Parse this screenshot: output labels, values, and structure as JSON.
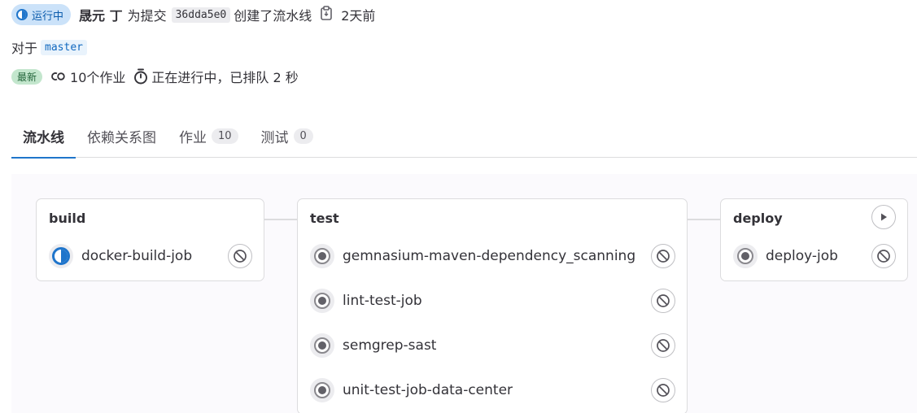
{
  "header": {
    "status_label": "运行中",
    "author": "晟元 丁",
    "commit_prefix": "为提交",
    "commit_sha": "36dda5e0",
    "commit_suffix": "创建了流水线",
    "time_ago": "2天前",
    "ref_prefix": "对于",
    "branch": "master",
    "latest_badge": "最新",
    "jobs_count": "10个作业",
    "running_status": "正在进行中，已排队 2 秒"
  },
  "tabs": [
    {
      "label": "流水线",
      "active": true
    },
    {
      "label": "依赖关系图"
    },
    {
      "label": "作业",
      "count": "10"
    },
    {
      "label": "测试",
      "count": "0"
    }
  ],
  "stages": [
    {
      "name": "build",
      "jobs": [
        {
          "name": "docker-build-job",
          "status": "running",
          "action": "cancel"
        }
      ]
    },
    {
      "name": "test",
      "jobs": [
        {
          "name": "gemnasium-maven-dependency_scanning",
          "status": "created",
          "action": "cancel"
        },
        {
          "name": "lint-test-job",
          "status": "created",
          "action": "cancel"
        },
        {
          "name": "semgrep-sast",
          "status": "created",
          "action": "cancel"
        },
        {
          "name": "unit-test-job-data-center",
          "status": "created",
          "action": "cancel"
        }
      ]
    },
    {
      "name": "deploy",
      "stage_action": "play",
      "jobs": [
        {
          "name": "deploy-job",
          "status": "created",
          "action": "cancel"
        }
      ]
    }
  ],
  "icons": {
    "status": "status-running-icon",
    "copy": "copy-to-clipboard-icon",
    "jobs": "pipeline-jobs-icon",
    "timer": "timer-icon",
    "cancel": "cancel-icon",
    "play": "play-icon"
  },
  "colors": {
    "accent": "#1f75cb",
    "running_badge_bg": "#cbe2f9",
    "latest_badge_bg": "#c3e6cd",
    "border": "#dcdcde"
  }
}
